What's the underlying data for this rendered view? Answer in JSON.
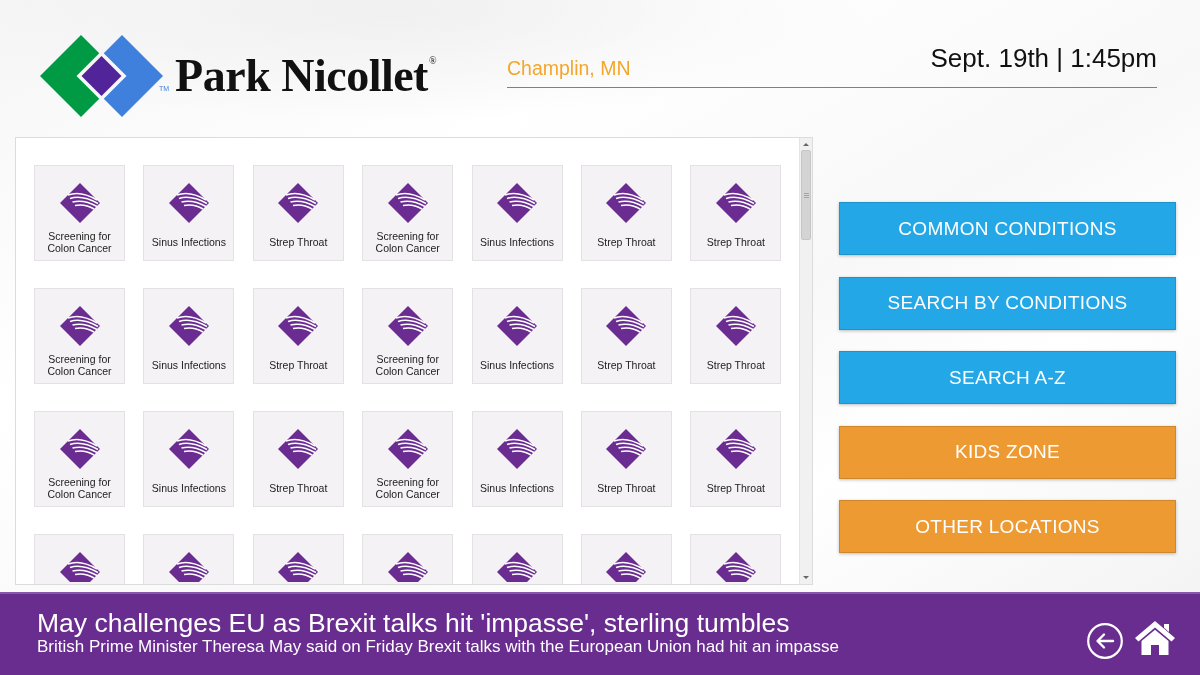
{
  "header": {
    "logo": {
      "wordmark": "Park Nicollet$^{®}$",
      "trademark": "TM"
    },
    "location": "Champlin, MN",
    "datetime": "Sept. 19th | 1:45pm"
  },
  "topic_tiles": [
    {
      "label": "Screening for Colon Cancer",
      "clipped": false
    },
    {
      "label": "Sinus Infections",
      "clipped": false
    },
    {
      "label": "Strep Throat",
      "clipped": false
    },
    {
      "label": "Screening for Colon Cancer",
      "clipped": false
    },
    {
      "label": "Sinus Infections",
      "clipped": false
    },
    {
      "label": "Strep Throat",
      "clipped": false
    },
    {
      "label": "Strep Throat",
      "clipped": false
    },
    {
      "label": "Screening for Colon Cancer",
      "clipped": false
    },
    {
      "label": "Sinus Infections",
      "clipped": false
    },
    {
      "label": "Strep Throat",
      "clipped": false
    },
    {
      "label": "Screening for Colon Cancer",
      "clipped": false
    },
    {
      "label": "Sinus Infections",
      "clipped": false
    },
    {
      "label": "Strep Throat",
      "clipped": false
    },
    {
      "label": "Strep Throat",
      "clipped": false
    },
    {
      "label": "Screening for Colon Cancer",
      "clipped": false
    },
    {
      "label": "Sinus Infections",
      "clipped": false
    },
    {
      "label": "Strep Throat",
      "clipped": false
    },
    {
      "label": "Screening for Colon Cancer",
      "clipped": false
    },
    {
      "label": "Sinus Infections",
      "clipped": false
    },
    {
      "label": "Strep Throat",
      "clipped": false
    },
    {
      "label": "Strep Throat",
      "clipped": false
    },
    {
      "clipped": true
    },
    {
      "clipped": true
    },
    {
      "clipped": true
    },
    {
      "clipped": true
    },
    {
      "clipped": true
    },
    {
      "clipped": true
    },
    {
      "clipped": true
    }
  ],
  "nav_buttons": [
    {
      "label": "COMMON CONDITIONS",
      "color": "#23a7e6"
    },
    {
      "label": "SEARCH BY CONDITIONS",
      "color": "#23a7e6"
    },
    {
      "label": "SEARCH A-Z",
      "color": "#23a7e6"
    },
    {
      "label": "KIDS ZONE",
      "color": "#ed9a33"
    },
    {
      "label": "OTHER LOCATIONS",
      "color": "#ed9a33"
    }
  ],
  "news_ticker": {
    "headline": "May challenges EU as Brexit talks hit 'impasse', sterling tumbles",
    "summary": "British Prime Minister Theresa May said on Friday Brexit talks with the European Union had hit an impasse"
  }
}
